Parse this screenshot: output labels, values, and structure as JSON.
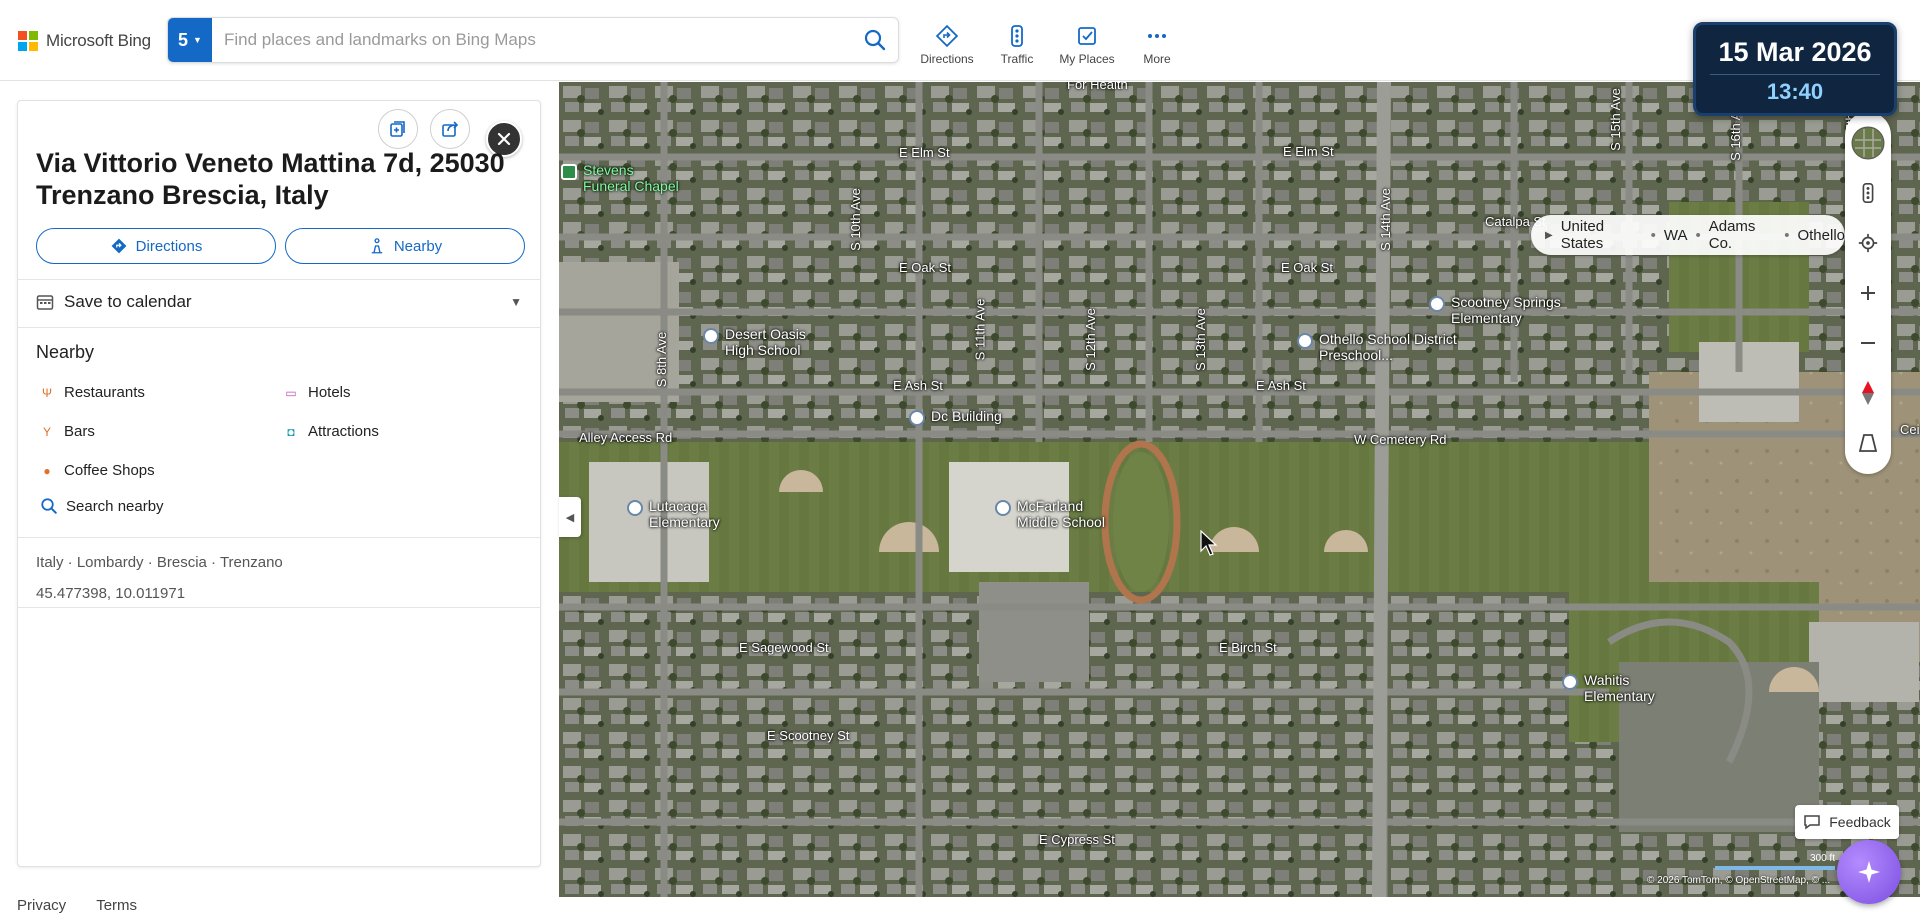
{
  "header": {
    "logo_text": "Microsoft Bing",
    "logo_colors": [
      "#f25022",
      "#7fba00",
      "#00a4ef",
      "#ffb900"
    ],
    "tab_count": "5",
    "search_placeholder": "Find places and landmarks on Bing Maps",
    "nav": [
      {
        "label": "Directions",
        "icon": "directions-icon"
      },
      {
        "label": "Traffic",
        "icon": "traffic-icon"
      },
      {
        "label": "My Places",
        "icon": "my-places-icon"
      },
      {
        "label": "More",
        "icon": "more-icon"
      }
    ],
    "accent_color": "#1469c7"
  },
  "datetime": {
    "date": "15 Mar 2026",
    "time": "13:40"
  },
  "panel": {
    "title": "Via Vittorio Veneto Mattina 7d, 25030 Trenzano Brescia, Italy",
    "directions_label": "Directions",
    "nearby_label": "Nearby",
    "calendar_label": "Save to calendar",
    "nearby_title": "Nearby",
    "nearby_items": [
      {
        "label": "Restaurants",
        "icon": "fork-icon"
      },
      {
        "label": "Hotels",
        "icon": "bed-icon"
      },
      {
        "label": "Bars",
        "icon": "cocktail-icon"
      },
      {
        "label": "Attractions",
        "icon": "camera-icon"
      },
      {
        "label": "Coffee Shops",
        "icon": "coffee-icon"
      }
    ],
    "search_nearby_label": "Search nearby",
    "region_path": "Italy · Lombardy · Brescia · Trenzano",
    "coordinates": "45.477398, 10.011971"
  },
  "footer": {
    "privacy": "Privacy",
    "terms": "Terms"
  },
  "map": {
    "breadcrumb": [
      "United States",
      "WA",
      "Adams Co.",
      "Othello"
    ],
    "feedback_label": "Feedback",
    "scale_label": "300 ft",
    "attribution": "© 2026 TomTom, © OpenStreetMap, © ...",
    "street_labels": [
      "For Health",
      "E Elm St",
      "E Elm St",
      "E Oak St",
      "E Oak St",
      "Catalpa St",
      "E Ash St",
      "E Ash St",
      "Alley Access Rd",
      "W Cemetery Rd",
      "E Sagewood St",
      "E Birch St",
      "E Scootney St",
      "E Cypress St",
      "S 14th Ave",
      "S 10th Ave",
      "S 11th Ave",
      "S 12th Ave",
      "S 13th Ave",
      "S 8th Ave",
      "S 15th Ave",
      "S 16th Ave",
      "S 17th Ave",
      "Cei"
    ],
    "pois": [
      {
        "name": "Stevens Funeral Chapel",
        "type": "green"
      },
      {
        "name": "Desert Oasis High School",
        "type": "school"
      },
      {
        "name": "Dc Building",
        "type": "school"
      },
      {
        "name": "Lutacaga Elementary",
        "type": "school"
      },
      {
        "name": "McFarland Middle School",
        "type": "school"
      },
      {
        "name": "Othello School District Preschool...",
        "type": "school"
      },
      {
        "name": "Scootney Springs Elementary",
        "type": "school"
      },
      {
        "name": "Wahitis Elementary",
        "type": "school"
      }
    ]
  }
}
